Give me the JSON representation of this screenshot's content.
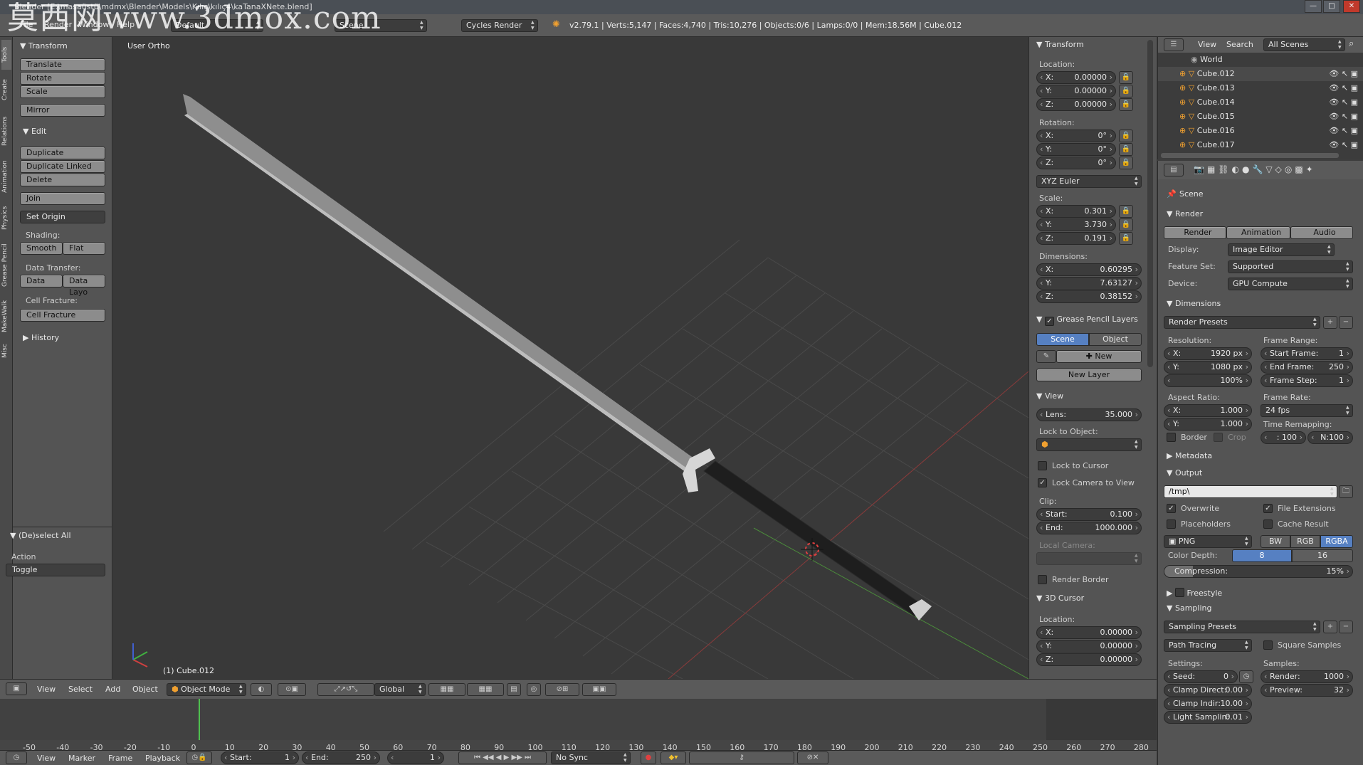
{
  "window": {
    "title": "Blender [E:\\masaüstü\\mdmx\\Blender\\Models\\Kılıç\\kılıç4\\kaTanaXNete.blend]",
    "watermark": "莫西网www.3dmox.com",
    "controls": [
      "—",
      "□",
      "✕"
    ]
  },
  "info": {
    "menus": [
      "File",
      "Render",
      "Window",
      "Help"
    ],
    "layout": "Default",
    "scene": "Scene",
    "engine": "Cycles Render",
    "stats": "v2.79.1 | Verts:5,147 | Faces:4,740 | Tris:10,276 | Objects:0/6 | Lamps:0/0 | Mem:18.56M | Cube.012"
  },
  "tool_tabs": [
    "Tools",
    "Create",
    "Relations",
    "Animation",
    "Physics",
    "Grease Pencil",
    "MakeWalk",
    "Misc"
  ],
  "tools": {
    "transform_header": "Transform",
    "translate": "Translate",
    "rotate": "Rotate",
    "scale": "Scale",
    "mirror": "Mirror",
    "edit_header": "Edit",
    "duplicate": "Duplicate",
    "duplicate_linked": "Duplicate Linked",
    "delete": "Delete",
    "join": "Join",
    "set_origin": "Set Origin",
    "shading_label": "Shading:",
    "smooth": "Smooth",
    "flat": "Flat",
    "data_transfer_label": "Data Transfer:",
    "data": "Data",
    "data_layout": "Data Layo",
    "cell_fracture_label": "Cell Fracture:",
    "cell_fracture": "Cell Fracture",
    "history_header": "History",
    "operator_header": "(De)select All",
    "action_label": "Action",
    "action_value": "Toggle"
  },
  "viewport": {
    "view_label": "User Ortho",
    "object_label": "(1) Cube.012"
  },
  "npanel": {
    "transform_header": "Transform",
    "location_label": "Location:",
    "location": [
      {
        "k": "X:",
        "v": "0.00000"
      },
      {
        "k": "Y:",
        "v": "0.00000"
      },
      {
        "k": "Z:",
        "v": "0.00000"
      }
    ],
    "rotation_label": "Rotation:",
    "rotation": [
      {
        "k": "X:",
        "v": "0°"
      },
      {
        "k": "Y:",
        "v": "0°"
      },
      {
        "k": "Z:",
        "v": "0°"
      }
    ],
    "rotation_mode": "XYZ Euler",
    "scale_label": "Scale:",
    "scale": [
      {
        "k": "X:",
        "v": "0.301"
      },
      {
        "k": "Y:",
        "v": "3.730"
      },
      {
        "k": "Z:",
        "v": "0.191"
      }
    ],
    "dimensions_label": "Dimensions:",
    "dimensions": [
      {
        "k": "X:",
        "v": "0.60295"
      },
      {
        "k": "Y:",
        "v": "7.63127"
      },
      {
        "k": "Z:",
        "v": "0.38152"
      }
    ],
    "grease_header": "Grease Pencil Layers",
    "gp_scene": "Scene",
    "gp_object": "Object",
    "gp_new": "New",
    "gp_new_layer": "New Layer",
    "view_header": "View",
    "lens_label": "Lens:",
    "lens_value": "35.000",
    "lock_to_object": "Lock to Object:",
    "lock_to_cursor": "Lock to Cursor",
    "lock_camera": "Lock Camera to View",
    "clip_label": "Clip:",
    "clip_start_label": "Start:",
    "clip_start": "0.100",
    "clip_end_label": "End:",
    "clip_end": "1000.000",
    "local_camera": "Local Camera:",
    "render_border": "Render Border",
    "cursor_header": "3D Cursor",
    "cursor_location": "Location:",
    "cursor": [
      {
        "k": "X:",
        "v": "0.00000"
      },
      {
        "k": "Y:",
        "v": "0.00000"
      },
      {
        "k": "Z:",
        "v": "0.00000"
      }
    ]
  },
  "outliner": {
    "view": "View",
    "search": "Search",
    "scenes": "All Scenes",
    "items": [
      "World",
      "Cube.012",
      "Cube.013",
      "Cube.014",
      "Cube.015",
      "Cube.016",
      "Cube.017"
    ]
  },
  "props": {
    "scene": "Scene",
    "render_header": "Render",
    "render_btn": "Render",
    "animation_btn": "Animation",
    "audio_btn": "Audio",
    "display_label": "Display:",
    "display_value": "Image Editor",
    "feature_label": "Feature Set:",
    "feature_value": "Supported",
    "device_label": "Device:",
    "device_value": "GPU Compute",
    "dimensions_header": "Dimensions",
    "render_presets": "Render Presets",
    "resolution_label": "Resolution:",
    "res_x_label": "X:",
    "res_x": "1920 px",
    "res_y_label": "Y:",
    "res_y": "1080 px",
    "res_pct": "100%",
    "frame_range_label": "Frame Range:",
    "start_frame_label": "Start Frame:",
    "start_frame": "1",
    "end_frame_label": "End Frame:",
    "end_frame": "250",
    "frame_step_label": "Frame Step:",
    "frame_step": "1",
    "aspect_label": "Aspect Ratio:",
    "aspect_x_label": "X:",
    "aspect_x": "1.000",
    "aspect_y_label": "Y:",
    "aspect_y": "1.000",
    "frame_rate_label": "Frame Rate:",
    "frame_rate": "24 fps",
    "time_remap_label": "Time Remapping:",
    "remap_old": ": 100",
    "remap_new": "N:100",
    "border": "Border",
    "crop": "Crop",
    "metadata_header": "Metadata",
    "output_header": "Output",
    "output_path": "/tmp\\",
    "overwrite": "Overwrite",
    "file_ext": "File Extensions",
    "placeholders": "Placeholders",
    "cache_result": "Cache Result",
    "format": "PNG",
    "bw": "BW",
    "rgb": "RGB",
    "rgba": "RGBA",
    "color_depth_label": "Color Depth:",
    "depth_8": "8",
    "depth_16": "16",
    "compression_label": "Compression:",
    "compression_value": "15%",
    "compression_fraction": 0.15,
    "freestyle_header": "Freestyle",
    "sampling_header": "Sampling",
    "sampling_presets": "Sampling Presets",
    "integrator": "Path Tracing",
    "square_samples": "Square Samples",
    "settings_label": "Settings:",
    "samples_label": "Samples:",
    "seed_label": "Seed:",
    "seed": "0",
    "render_samples_label": "Render:",
    "render_samples": "1000",
    "clamp_direct_label": "Clamp Direct:",
    "clamp_direct": "0.00",
    "preview_label": "Preview:",
    "preview_samples": "32",
    "clamp_indirect_label": "Clamp Indir:",
    "clamp_indirect": "10.00",
    "light_sampling_label": "Light Samplin:",
    "light_sampling": "0.01"
  },
  "viewheader": {
    "menus": [
      "View",
      "Select",
      "Add",
      "Object"
    ],
    "mode": "Object Mode",
    "orientation": "Global"
  },
  "timeline": {
    "ticks": [
      "-50",
      "-40",
      "-30",
      "-20",
      "-10",
      "0",
      "10",
      "20",
      "30",
      "40",
      "50",
      "60",
      "70",
      "80",
      "90",
      "100",
      "110",
      "120",
      "130",
      "140",
      "150",
      "160",
      "170",
      "180",
      "190",
      "200",
      "210",
      "220",
      "230",
      "240",
      "250",
      "260",
      "270",
      "280"
    ],
    "current_frame": "1"
  },
  "timeheader": {
    "menus": [
      "View",
      "Marker",
      "Frame",
      "Playback"
    ],
    "start_label": "Start:",
    "start": "1",
    "end_label": "End:",
    "end": "250",
    "current": "1",
    "sync": "No Sync"
  },
  "colors": {
    "accent": "#5680c2",
    "bg": "#393939",
    "panel": "#545454",
    "header": "#5a5a5a"
  }
}
